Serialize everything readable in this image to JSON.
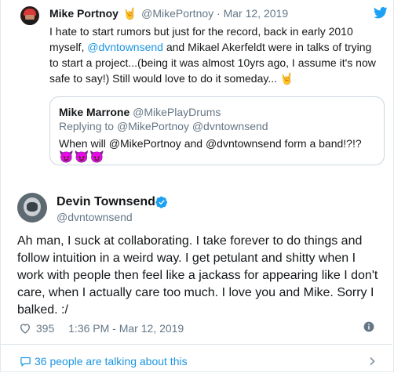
{
  "quoted": {
    "name": "Mike Portnoy",
    "emoji": "🤘",
    "handle": "@MikePortnoy",
    "separator": "·",
    "date": "Mar 12, 2019",
    "text_parts": [
      "I hate to start rumors but just for the record, back in early 2010 myself, ",
      "@dvntownsend",
      " and Mikael Akerfeldt were in talks of trying to start a project...(being it was almost 10yrs ago, I assume it's now safe to say!) Still would love to do it someday... ",
      "🤘"
    ],
    "inner": {
      "name": "Mike Marrone",
      "handle": "@MikePlayDrums",
      "replying_prefix": "Replying to ",
      "replying_to": "@MikePortnoy @dvntownsend",
      "text": "When will @MikePortnoy and @dvntownsend form a band!?!?",
      "emojis": "😈😈😈"
    }
  },
  "tweet": {
    "name": "Devin Townsend",
    "handle": "@dvntownsend",
    "text": "Ah man, I suck at collaborating. I take forever to do things and follow intuition in a weird way. I get petulant and shitty when I work with people then feel like a jackass for appearing like I don't care, when I actually care too much. I love you and Mike. Sorry I balked. :/",
    "likes": "395",
    "timestamp": "1:36 PM - Mar 12, 2019"
  },
  "footer": {
    "talking": "36 people are talking about this"
  },
  "colors": {
    "link": "#1b95e0",
    "muted": "#657786",
    "text": "#14171a",
    "verified": "#1da1f2"
  },
  "icons": [
    "twitter-bird-icon",
    "verified-icon",
    "heart-icon",
    "info-icon",
    "speech-bubble-icon",
    "chevron-right-icon"
  ]
}
